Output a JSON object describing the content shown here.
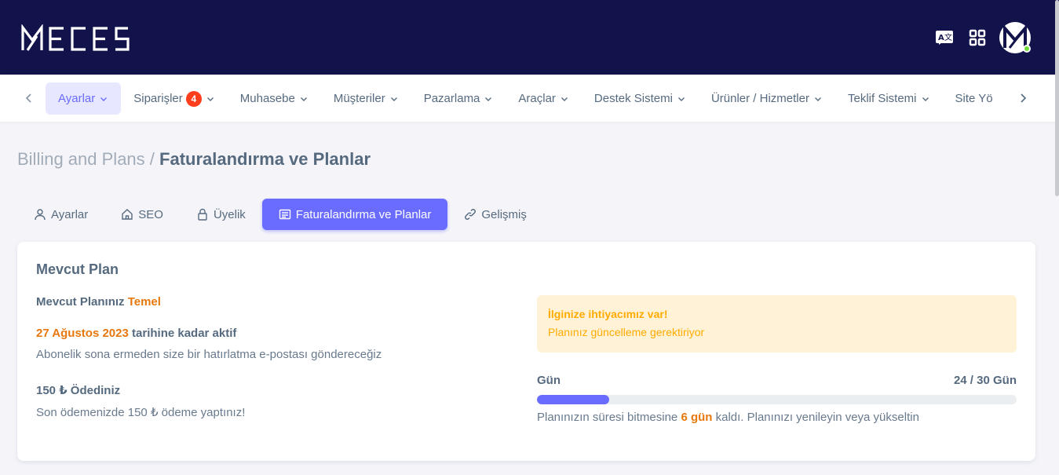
{
  "header": {
    "logo_text": "MECES",
    "icons": [
      "translate-icon",
      "apps-grid-icon"
    ],
    "avatar_letter": "M",
    "avatar_status": "online"
  },
  "nav": {
    "items": [
      {
        "label": "Ayarlar",
        "active": true
      },
      {
        "label": "Siparişler",
        "badge": "4"
      },
      {
        "label": "Muhasebe"
      },
      {
        "label": "Müşteriler"
      },
      {
        "label": "Pazarlama"
      },
      {
        "label": "Araçlar"
      },
      {
        "label": "Destek Sistemi"
      },
      {
        "label": "Ürünler / Hizmetler"
      },
      {
        "label": "Teklif Sistemi"
      },
      {
        "label": "Site Yö"
      }
    ]
  },
  "breadcrumb": {
    "parent": "Billing and Plans /",
    "current": "Faturalandırma ve Planlar"
  },
  "tabs": [
    {
      "label": "Ayarlar",
      "icon": "user-icon"
    },
    {
      "label": "SEO",
      "icon": "home-icon"
    },
    {
      "label": "Üyelik",
      "icon": "lock-icon"
    },
    {
      "label": "Faturalandırma ve Planlar",
      "icon": "billing-icon",
      "active": true
    },
    {
      "label": "Gelişmiş",
      "icon": "link-icon"
    }
  ],
  "plan": {
    "title": "Mevcut Plan",
    "current_label": "Mevcut Planınız",
    "current_value": "Temel",
    "active_date": "27 Ağustos 2023",
    "active_suffix": "tarihine kadar aktif",
    "reminder": "Abonelik sona ermeden size bir hatırlatma e-postası göndereceğiz",
    "price_title": "150 ₺ Ödediniz",
    "price_note": "Son ödemenizde 150 ₺ ödeme yaptınız!"
  },
  "alert": {
    "title": "İlginize ihtiyacımız var!",
    "text": "Planınız güncelleme gerektiriyor"
  },
  "progress": {
    "label": "Gün",
    "count": "24 / 30 Gün",
    "fraction": 0.15,
    "note_prefix": "Planınızın süresi bitmesine",
    "note_highlight": "6 gün",
    "note_suffix": "kaldı. Planınızı yenileyin veya yükseltin"
  },
  "colors": {
    "topbar": "#13134b",
    "primary": "#696cff",
    "accent": "#e7780e",
    "warning": "#ffab00",
    "danger": "#ff3e1d"
  }
}
